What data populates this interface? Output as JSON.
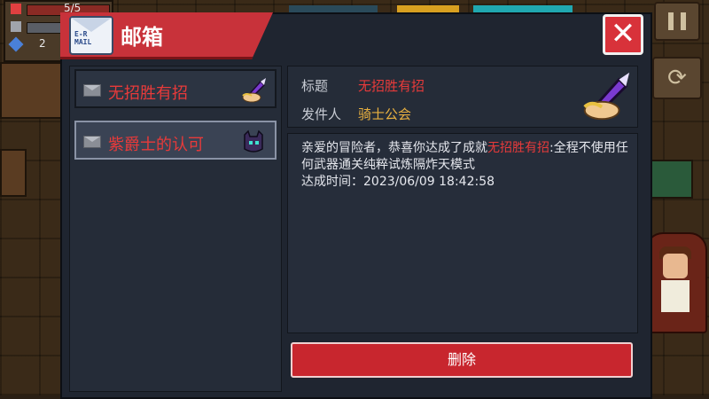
{
  "hud": {
    "hp_text": "5/5",
    "coin_text": "2"
  },
  "mailbox": {
    "title": "邮箱",
    "icon_text": "E-R\nMAIL",
    "close_icon": "close-icon"
  },
  "mail_list": [
    {
      "title": "无招胜有招",
      "badge_icon": "sword-in-hand-icon"
    },
    {
      "title": "紫爵士的认可",
      "badge_icon": "purple-helmet-icon"
    }
  ],
  "detail": {
    "title_label": "标题",
    "title_value": "无招胜有招",
    "sender_label": "发件人",
    "sender_value": "骑士公会",
    "body_intro": "亲爱的冒险者，恭喜你达成了成就",
    "body_highlight": "无招胜有招",
    "body_rest": ":全程不使用任何武器通关纯粹试炼隔炸天模式",
    "completion_line": "达成时间：2023/06/09 18:42:58",
    "delete_label": "删除"
  },
  "colors": {
    "accent_red": "#c8323a",
    "highlight_red": "#e83a3a",
    "sender_gold": "#e8b040",
    "panel_bg": "#1f2530"
  }
}
